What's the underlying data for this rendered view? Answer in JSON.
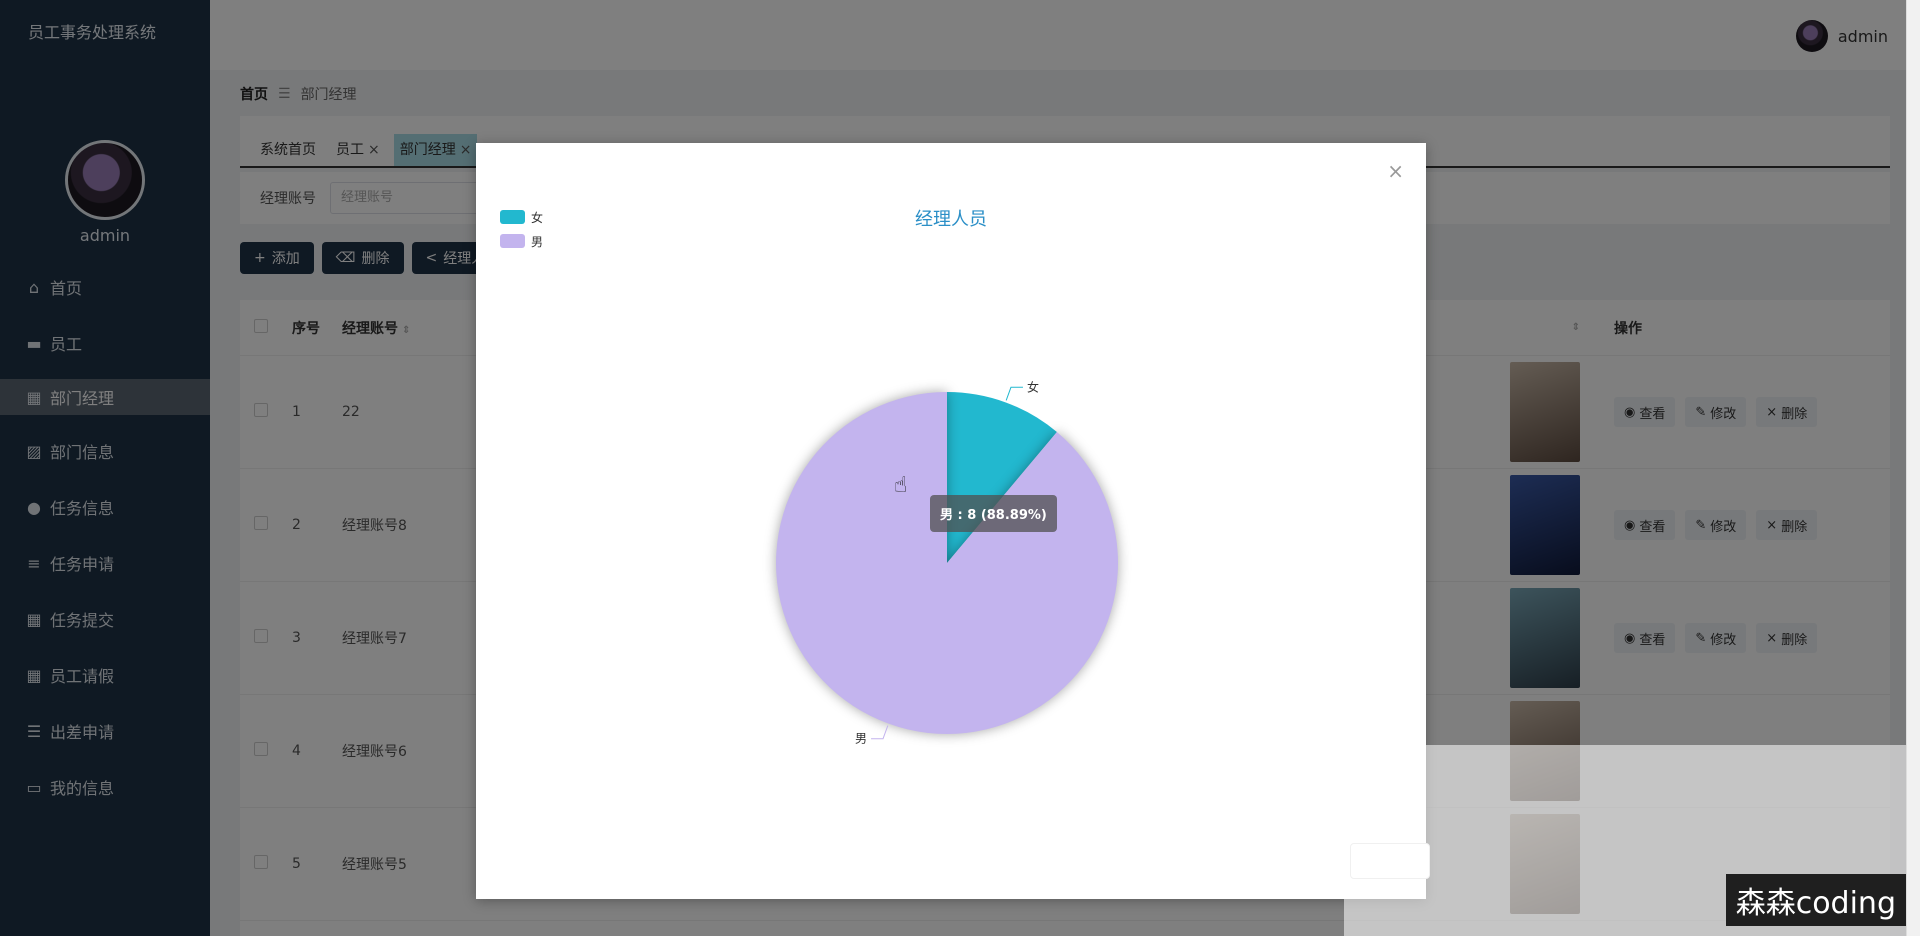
{
  "app": {
    "title": "员工事务处理系统",
    "user": "admin"
  },
  "sidebar": {
    "items": [
      {
        "label": "首页",
        "icon": "home-icon"
      },
      {
        "label": "员工",
        "icon": "monitor-icon"
      },
      {
        "label": "部门经理",
        "icon": "grid-icon"
      },
      {
        "label": "部门信息",
        "icon": "chart-icon"
      },
      {
        "label": "任务信息",
        "icon": "bulb-icon"
      },
      {
        "label": "任务申请",
        "icon": "list-icon"
      },
      {
        "label": "任务提交",
        "icon": "grid-icon"
      },
      {
        "label": "员工请假",
        "icon": "grid-icon"
      },
      {
        "label": "出差申请",
        "icon": "sliders-icon"
      },
      {
        "label": "我的信息",
        "icon": "card-icon"
      }
    ],
    "active_index": 2
  },
  "breadcrumb": {
    "home": "首页",
    "current": "部门经理"
  },
  "tabs": [
    {
      "label": "系统首页",
      "closable": false
    },
    {
      "label": "员工",
      "closable": true
    },
    {
      "label": "部门经理",
      "closable": true
    }
  ],
  "search": {
    "label": "经理账号",
    "placeholder": "经理账号"
  },
  "toolbar": {
    "add_label": "添加",
    "delete_label": "删除",
    "stats_label": "经理人"
  },
  "table": {
    "headers": {
      "index": "序号",
      "account": "经理账号",
      "actions": "操作"
    },
    "rows": [
      {
        "index": "1",
        "account": "22"
      },
      {
        "index": "2",
        "account": "经理账号8"
      },
      {
        "index": "3",
        "account": "经理账号7"
      },
      {
        "index": "4",
        "account": "经理账号6"
      },
      {
        "index": "5",
        "account": "经理账号5"
      }
    ],
    "ops": {
      "view": "查看",
      "edit": "修改",
      "delete": "删除"
    }
  },
  "dialog": {
    "close": "×"
  },
  "chart_data": {
    "type": "pie",
    "title": "经理人员",
    "slices": [
      {
        "name": "女",
        "value": 1,
        "color": "#22b8cf"
      },
      {
        "name": "男",
        "value": 8,
        "color": "#c3b4ee"
      }
    ],
    "legend_position": "top-left",
    "tooltip": "男 : 8 (88.89%)"
  },
  "watermark": "森森coding"
}
